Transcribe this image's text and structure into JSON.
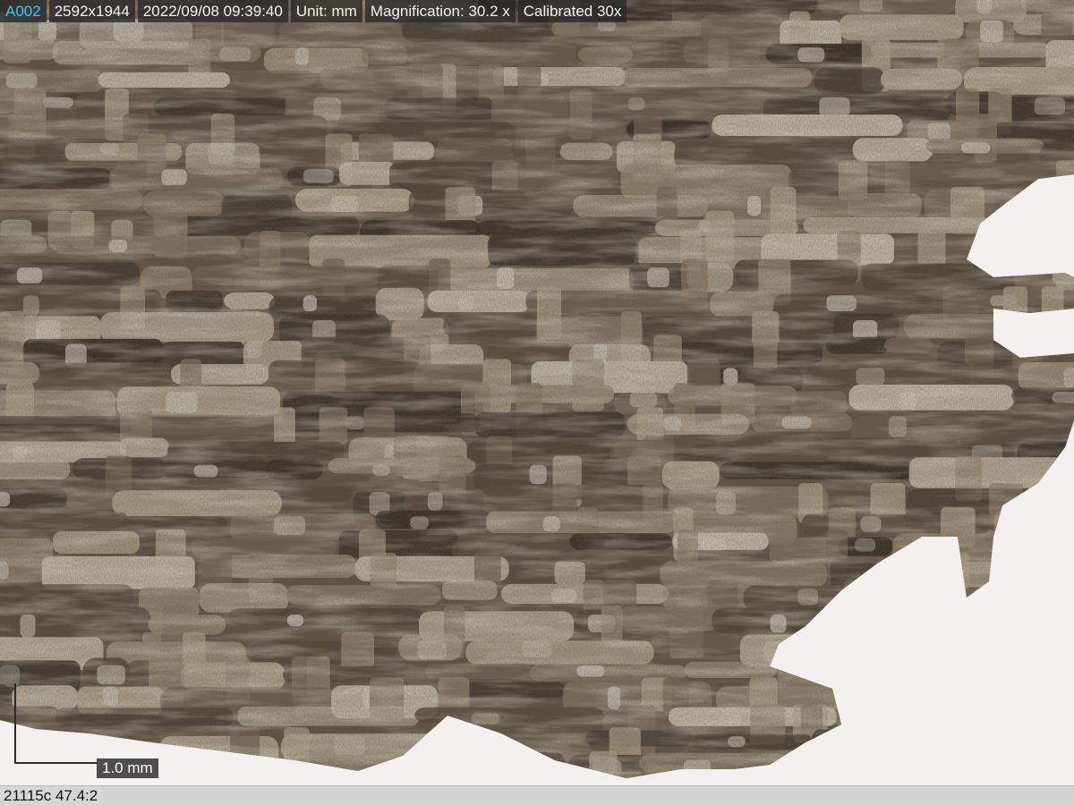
{
  "toolbar": {
    "image_id": "A002",
    "resolution": "2592x1944",
    "datetime": "2022/09/08 09:39:40",
    "unit": "Unit: mm",
    "magnification": "Magnification:  30.2 x",
    "calibration": "Calibrated 30x"
  },
  "scale_bar": {
    "label": "1.0 mm"
  },
  "status_bar": {
    "text": "21115c 47.4:2"
  },
  "colors": {
    "image_id": "#38c8f0",
    "background": "#f2f1f0",
    "fiber_dark": "#3a3228",
    "fiber_mid": "#6f6250",
    "fiber_light": "#bfb4a0"
  }
}
